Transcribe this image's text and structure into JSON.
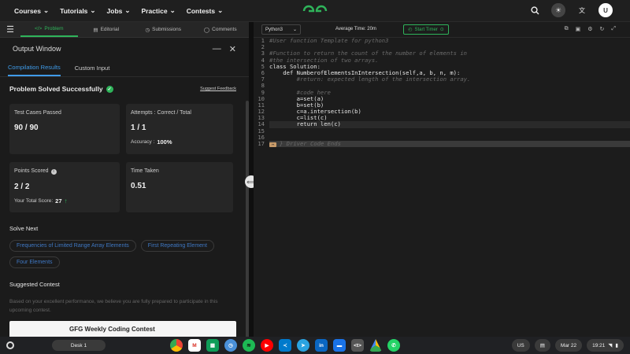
{
  "topnav": {
    "menu": [
      "Courses",
      "Tutorials",
      "Jobs",
      "Practice",
      "Contests"
    ],
    "avatar_letter": "U"
  },
  "tabs": [
    "Problem",
    "Editorial",
    "Submissions",
    "Comments"
  ],
  "output": {
    "title": "Output Window",
    "subtabs": [
      "Compilation Results",
      "Custom Input"
    ],
    "status": "Problem Solved Successfully",
    "feedback": "Suggest Feedback",
    "cards": {
      "tests_label": "Test Cases Passed",
      "tests_value": "90 / 90",
      "attempts_label": "Attempts : Correct / Total",
      "attempts_value": "1 / 1",
      "accuracy_label": "Accuracy :",
      "accuracy_value": "100%",
      "points_label": "Points Scored",
      "points_value": "2 / 2",
      "total_label": "Your Total Score:",
      "total_value": "27",
      "time_label": "Time Taken",
      "time_value": "0.51"
    },
    "solve_next_title": "Solve Next",
    "solve_next": [
      "Frequencies of Limited Range Array Elements",
      "First Repeating Element",
      "Four Elements"
    ],
    "suggested_title": "Suggested Contest",
    "suggested_desc": "Based on your excellent performance, we believe you are fully prepared to participate in this upcoming contest.",
    "contest_title": "GFG Weekly Coding Contest"
  },
  "editor": {
    "language": "Python3",
    "avg_time": "Average Time: 20m",
    "timer_label": "Start Timer",
    "lines": [
      {
        "n": "1",
        "t": "#User function Template for python3",
        "c": "cm"
      },
      {
        "n": "2",
        "t": "",
        "c": "txt"
      },
      {
        "n": "3",
        "t": "#Function to return the count of the number of elements in",
        "c": "cm"
      },
      {
        "n": "4",
        "t": "#the intersection of two arrays.",
        "c": "cm"
      },
      {
        "n": "5",
        "t": "class Solution:",
        "c": "txt"
      },
      {
        "n": "6",
        "t": "    def NumberofElementsInIntersection(self,a, b, n, m):",
        "c": "txt"
      },
      {
        "n": "7",
        "t": "        #return: expected length of the intersection array.",
        "c": "cm"
      },
      {
        "n": "8",
        "t": "",
        "c": "txt"
      },
      {
        "n": "9",
        "t": "        #code here",
        "c": "cm"
      },
      {
        "n": "10",
        "t": "        a=set(a)",
        "c": "txt"
      },
      {
        "n": "11",
        "t": "        b=set(b)",
        "c": "txt"
      },
      {
        "n": "12",
        "t": "        c=a.intersection(b)",
        "c": "txt"
      },
      {
        "n": "13",
        "t": "        c=list(c)",
        "c": "txt"
      },
      {
        "n": "14",
        "t": "        return len(c)",
        "c": "txt hl"
      },
      {
        "n": "15",
        "t": "",
        "c": "txt"
      },
      {
        "n": "16",
        "t": "",
        "c": "txt"
      },
      {
        "n": "17",
        "t": "} Driver Code Ends",
        "c": "cm collapsed"
      }
    ]
  },
  "taskbar": {
    "desk": "Desk 1",
    "lang": "US",
    "date": "Mar 22",
    "time": "19:21"
  },
  "colors": {
    "accent_green": "#2fb45a",
    "accent_blue": "#3f9be8"
  }
}
